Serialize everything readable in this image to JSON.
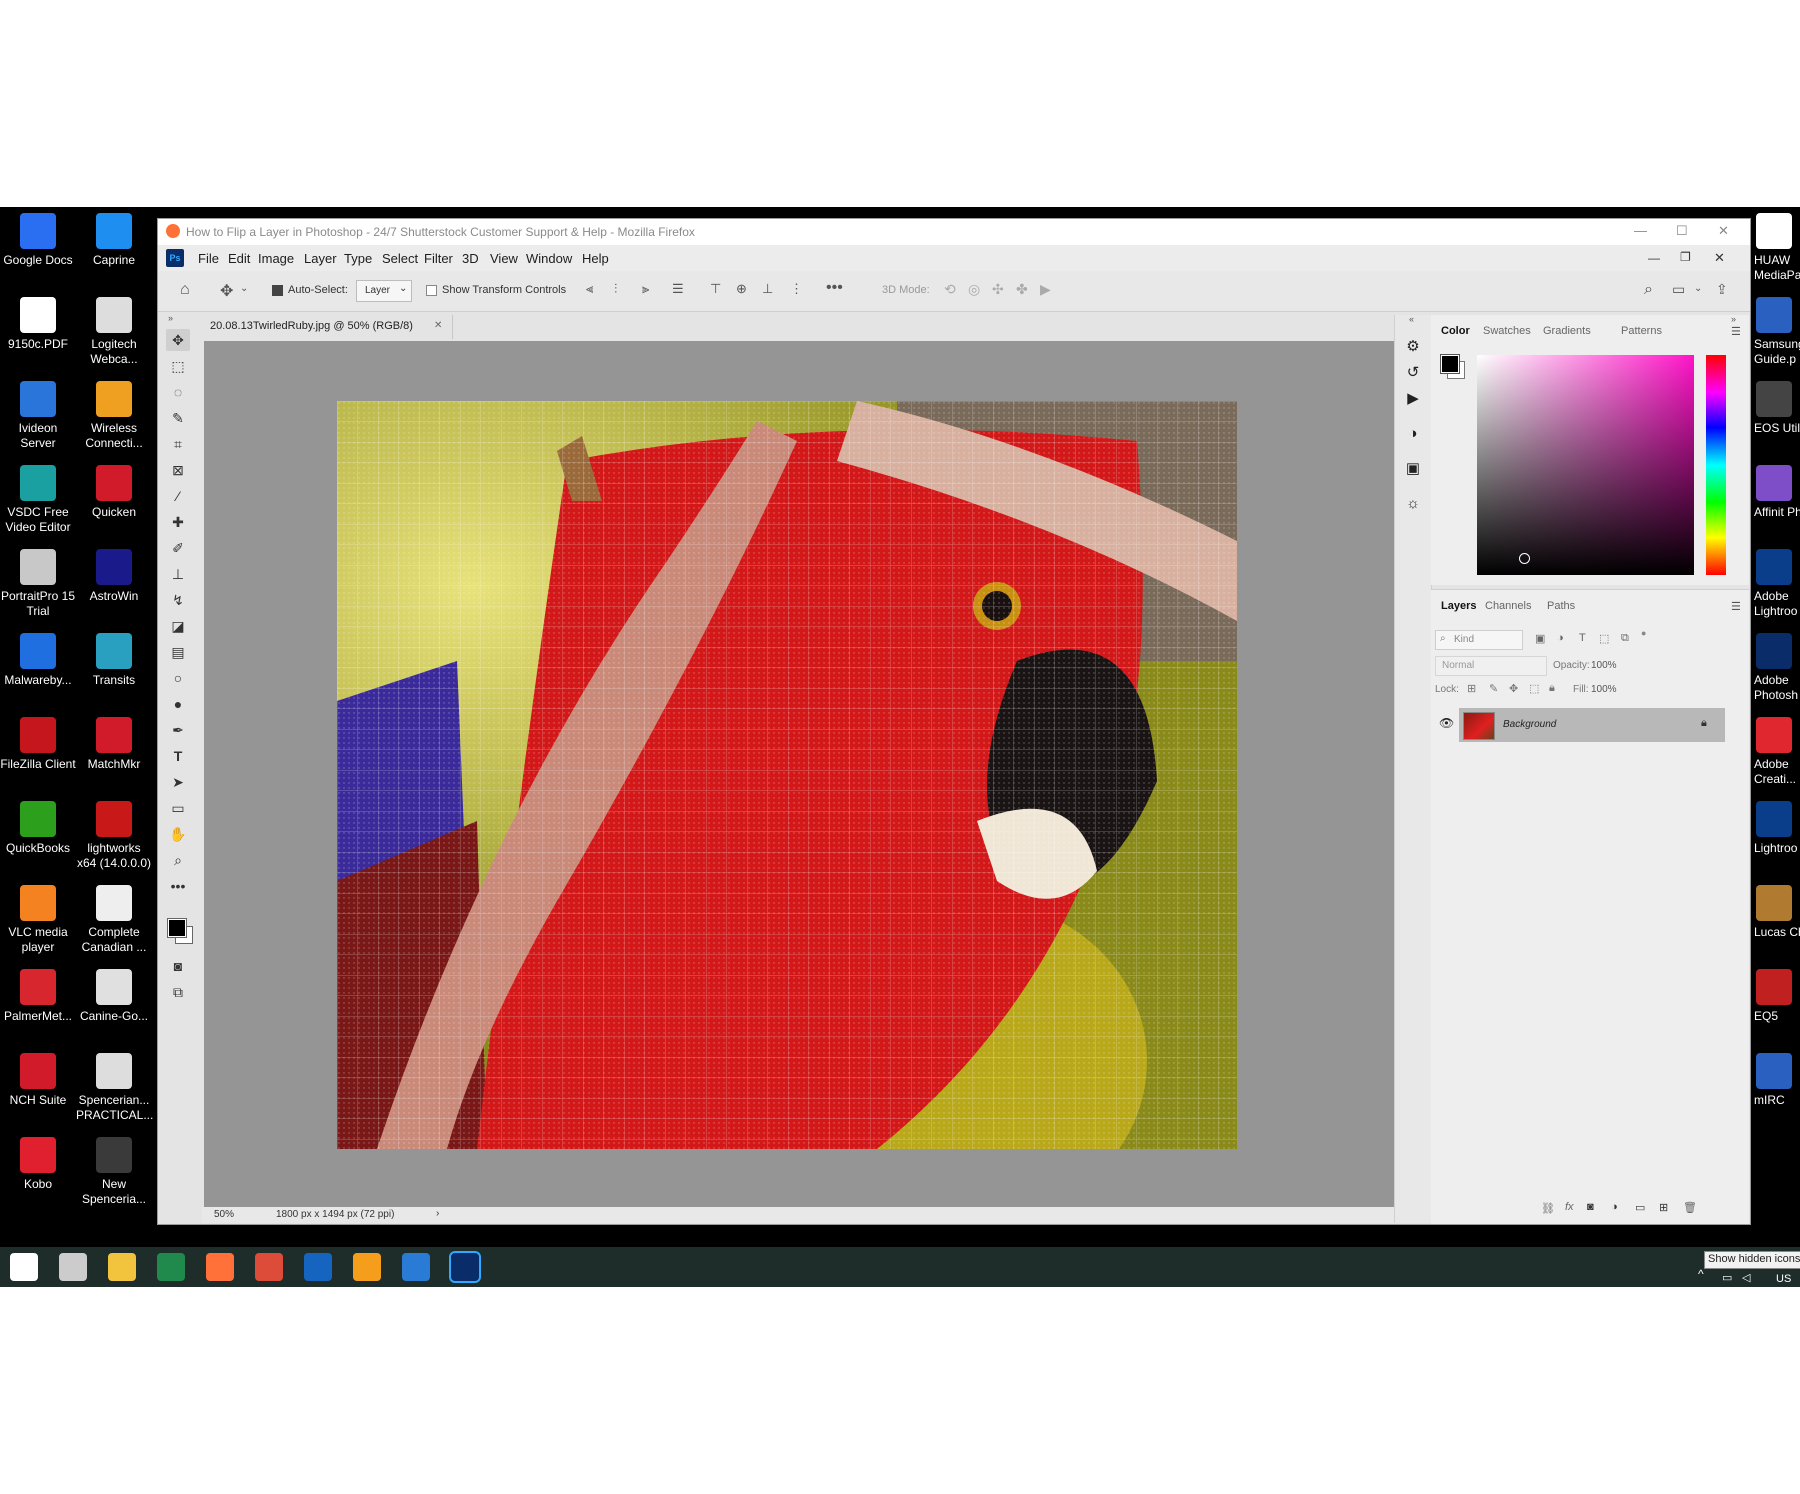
{
  "browser": {
    "title": "How to Flip a Layer in Photoshop - 24/7 Shutterstock Customer Support & Help - Mozilla Firefox"
  },
  "desktop": {
    "left_icons": [
      {
        "label": "Google Docs",
        "color": "#2a6ff2"
      },
      {
        "label": "Caprine",
        "color": "#1f8ef1"
      },
      {
        "label": "9150c.PDF",
        "color": "#ffffff"
      },
      {
        "label": "Logitech Webca...",
        "color": "#dddddd"
      },
      {
        "label": "Ivideon Server",
        "color": "#2a75d9"
      },
      {
        "label": "Wireless Connecti...",
        "color": "#f0a020"
      },
      {
        "label": "VSDC Free Video Editor",
        "color": "#1aa0a0"
      },
      {
        "label": "Quicken",
        "color": "#d11a2a"
      },
      {
        "label": "PortraitPro 15 Trial",
        "color": "#c8c8c8"
      },
      {
        "label": "AstroWin",
        "color": "#1a1a8a"
      },
      {
        "label": "Malwareby...",
        "color": "#1f6fe0"
      },
      {
        "label": "Transits",
        "color": "#2aa0c0"
      },
      {
        "label": "FileZilla Client",
        "color": "#c4161c"
      },
      {
        "label": "MatchMkr",
        "color": "#d11a2a"
      },
      {
        "label": "QuickBooks",
        "color": "#2ca01c"
      },
      {
        "label": "lightworks x64 (14.0.0.0)",
        "color": "#c81818"
      },
      {
        "label": "VLC media player",
        "color": "#f58220"
      },
      {
        "label": "Complete Canadian ...",
        "color": "#eeeeee"
      },
      {
        "label": "PalmerMet...",
        "color": "#d8262e"
      },
      {
        "label": "Canine-Go...",
        "color": "#e0e0e0"
      },
      {
        "label": "NCH Suite",
        "color": "#d11a2a"
      },
      {
        "label": "Spencerian... PRACTICAL...",
        "color": "#dddddd"
      },
      {
        "label": "Kobo",
        "color": "#e0202e"
      },
      {
        "label": "New Spenceria...",
        "color": "#3a3a3a"
      }
    ],
    "right_icons": [
      {
        "label": "HUAW MediaPa",
        "color": "#ffffff"
      },
      {
        "label": "Samsung Guide.p",
        "color": "#2a60c0"
      },
      {
        "label": "EOS Util",
        "color": "#444444"
      },
      {
        "label": "Affinit Photo",
        "color": "#7e4ec9"
      },
      {
        "label": "Adobe Lightroo",
        "color": "#0a3d8a"
      },
      {
        "label": "Adobe Photosh",
        "color": "#0a2d6a"
      },
      {
        "label": "Adobe Creati...",
        "color": "#e0262e"
      },
      {
        "label": "Lightroo CC",
        "color": "#0a3d8a"
      },
      {
        "label": "Lucas Ch",
        "color": "#b07a30"
      },
      {
        "label": "EQ5",
        "color": "#c02020"
      },
      {
        "label": "mIRC",
        "color": "#2a60c0"
      }
    ]
  },
  "photoshop": {
    "menu": [
      "File",
      "Edit",
      "Image",
      "Layer",
      "Type",
      "Select",
      "Filter",
      "3D",
      "View",
      "Window",
      "Help"
    ],
    "options": {
      "auto_select_label": "Auto-Select:",
      "auto_select_value": "Layer",
      "show_transform_label": "Show Transform Controls",
      "three_d_mode_label": "3D Mode:"
    },
    "document_tab": "20.08.13TwirledRuby.jpg @ 50% (RGB/8)",
    "status": {
      "zoom": "50%",
      "dimensions": "1800 px x 1494 px (72 ppi)"
    },
    "color_panel": {
      "tabs": [
        "Color",
        "Swatches",
        "Gradients",
        "Patterns"
      ],
      "active": "Color",
      "foreground": "#000000",
      "hue_color": "#ff14c8"
    },
    "layers_panel": {
      "tabs": [
        "Layers",
        "Channels",
        "Paths"
      ],
      "active": "Layers",
      "filter_label": "Kind",
      "blend_mode": "Normal",
      "opacity_label": "Opacity:",
      "opacity": "100%",
      "lock_label": "Lock:",
      "fill_label": "Fill:",
      "fill": "100%",
      "layers": [
        {
          "name": "Background",
          "locked": true,
          "visible": true
        }
      ]
    }
  },
  "taskbar": {
    "tooltip": "Show hidden icons",
    "locale": "US",
    "apps": [
      {
        "name": "windows-start",
        "color": "#ffffff"
      },
      {
        "name": "task-view",
        "color": "#cccccc"
      },
      {
        "name": "file-explorer",
        "color": "#f2c43d"
      },
      {
        "name": "spreadsheet",
        "color": "#1f8a4c"
      },
      {
        "name": "firefox",
        "color": "#ff7139"
      },
      {
        "name": "chrome",
        "color": "#dd4b39"
      },
      {
        "name": "mail",
        "color": "#1565c0"
      },
      {
        "name": "orange-app",
        "color": "#f59e1b"
      },
      {
        "name": "photos",
        "color": "#2a7bd5"
      },
      {
        "name": "photoshop",
        "color": "#0a2d6a"
      }
    ]
  }
}
